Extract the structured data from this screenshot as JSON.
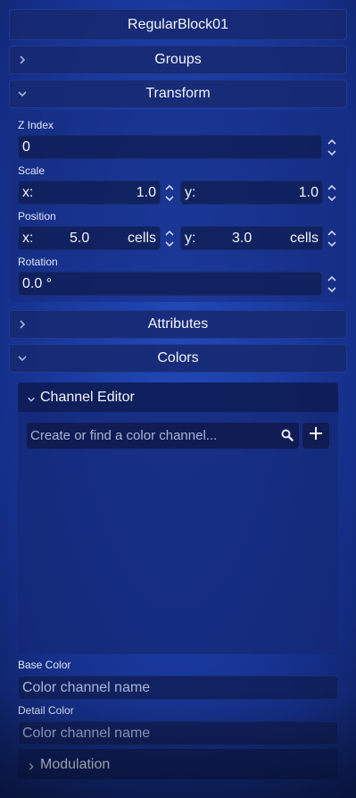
{
  "object_name": "RegularBlock01",
  "sections": {
    "groups": "Groups",
    "transform": "Transform",
    "attributes": "Attributes",
    "colors": "Colors"
  },
  "transform": {
    "z_index": {
      "label": "Z Index",
      "value": "0"
    },
    "scale": {
      "label": "Scale",
      "x_label": "x:",
      "x_value": "1.0",
      "y_label": "y:",
      "y_value": "1.0"
    },
    "position": {
      "label": "Position",
      "x_label": "x:",
      "x_value": "5.0",
      "y_label": "y:",
      "y_value": "3.0",
      "unit": "cells"
    },
    "rotation": {
      "label": "Rotation",
      "value": "0.0 °"
    }
  },
  "colors": {
    "channel_editor": {
      "title": "Channel Editor",
      "search_placeholder": "Create or find a color channel..."
    },
    "base_color": {
      "label": "Base Color",
      "placeholder": "Color channel name"
    },
    "detail_color": {
      "label": "Detail Color",
      "placeholder": "Color channel name"
    },
    "modulation": "Modulation"
  }
}
